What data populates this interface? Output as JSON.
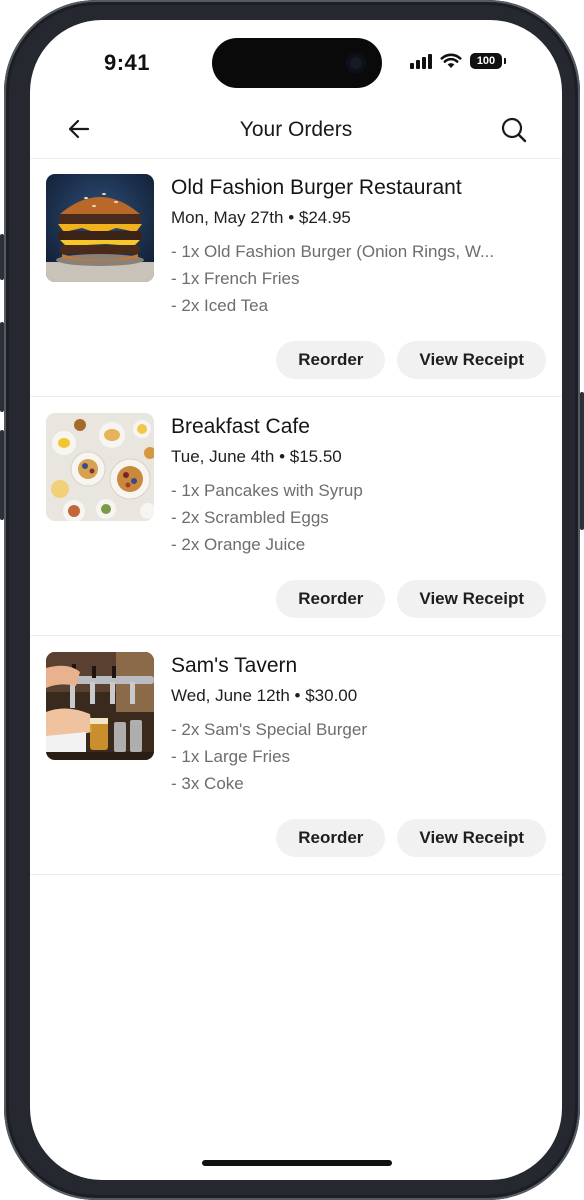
{
  "status_bar": {
    "time": "9:41",
    "battery": "100"
  },
  "nav": {
    "title": "Your Orders",
    "back_icon": "arrow-left-icon",
    "search_icon": "search-icon"
  },
  "orders": [
    {
      "restaurant": "Old Fashion Burger Restaurant",
      "date": "Mon, May 27th",
      "separator": "•",
      "total": "$24.95",
      "items": [
        "- 1x Old Fashion Burger (Onion Rings, W...",
        "- 1x French Fries",
        "- 2x Iced Tea"
      ],
      "image": "burger-photo",
      "reorder_label": "Reorder",
      "receipt_label": "View Receipt"
    },
    {
      "restaurant": "Breakfast Cafe",
      "date": "Tue, June 4th",
      "separator": "•",
      "total": "$15.50",
      "items": [
        "- 1x Pancakes with Syrup",
        "- 2x Scrambled Eggs",
        "- 2x Orange Juice"
      ],
      "image": "breakfast-table-photo",
      "reorder_label": "Reorder",
      "receipt_label": "View Receipt"
    },
    {
      "restaurant": "Sam's Tavern",
      "date": "Wed, June 12th",
      "separator": "•",
      "total": "$30.00",
      "items": [
        "- 2x Sam's Special Burger",
        "- 1x Large Fries",
        "- 3x Coke"
      ],
      "image": "bar-tap-photo",
      "reorder_label": "Reorder",
      "receipt_label": "View Receipt"
    }
  ]
}
